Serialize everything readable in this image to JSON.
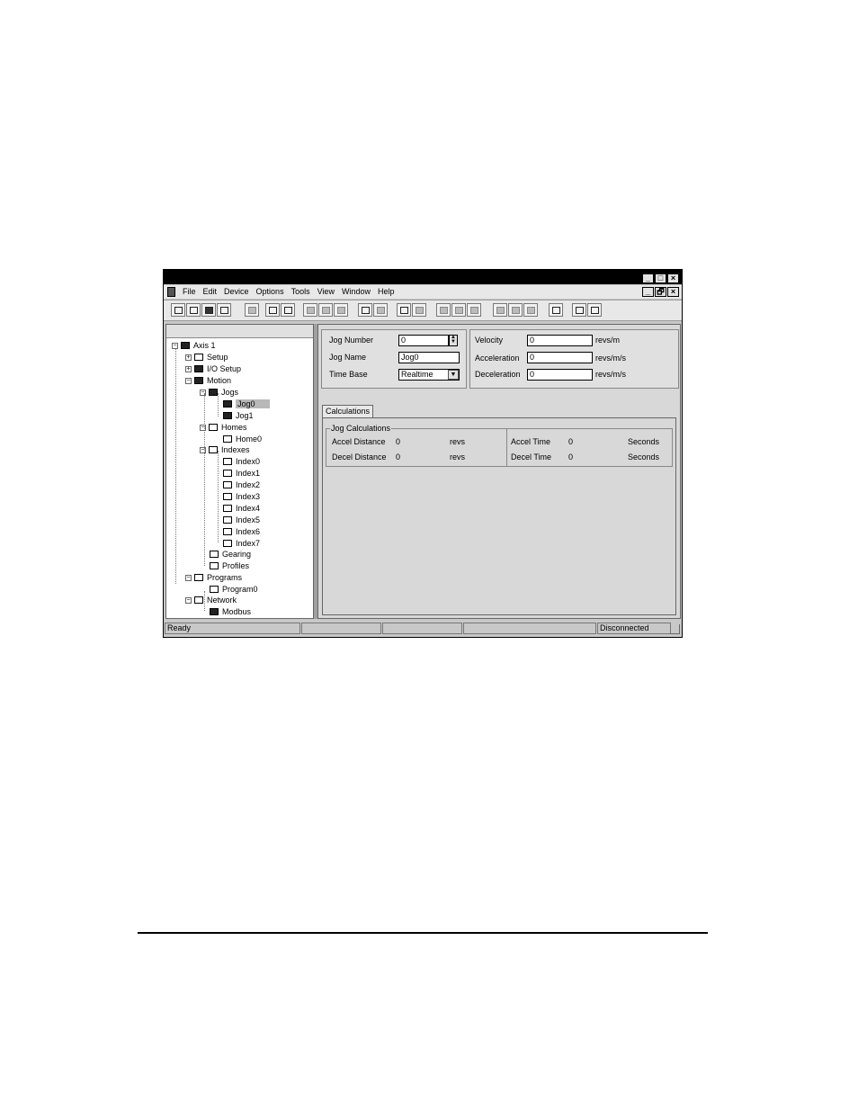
{
  "menubar": {
    "items": [
      "File",
      "Edit",
      "Device",
      "Options",
      "Tools",
      "View",
      "Window",
      "Help"
    ]
  },
  "window_controls": {
    "minimize": "_",
    "maximize": "□",
    "close": "×",
    "restore": "🗗"
  },
  "tree": {
    "root": "Axis 1",
    "setup": "Setup",
    "io_setup": "I/O Setup",
    "motion": "Motion",
    "jogs": "Jogs",
    "jog0": "Jog0",
    "jog1": "Jog1",
    "homes": "Homes",
    "home0": "Home0",
    "indexes": "Indexes",
    "index0": "Index0",
    "index1": "Index1",
    "index2": "Index2",
    "index3": "Index3",
    "index4": "Index4",
    "index5": "Index5",
    "index6": "Index6",
    "index7": "Index7",
    "gearing": "Gearing",
    "profiles": "Profiles",
    "programs": "Programs",
    "program0": "Program0",
    "network": "Network",
    "modbus": "Modbus"
  },
  "jog_form": {
    "jog_number_label": "Jog Number",
    "jog_number_value": "0",
    "jog_name_label": "Jog Name",
    "jog_name_value": "Jog0",
    "time_base_label": "Time Base",
    "time_base_value": "Realtime",
    "velocity_label": "Velocity",
    "velocity_value": "0",
    "velocity_unit": "revs/m",
    "acceleration_label": "Acceleration",
    "acceleration_value": "0",
    "acceleration_unit": "revs/m/s",
    "deceleration_label": "Deceleration",
    "deceleration_value": "0",
    "deceleration_unit": "revs/m/s"
  },
  "calculations": {
    "tab_label": "Calculations",
    "group_label": "Jog Calculations",
    "accel_distance_label": "Accel Distance",
    "accel_distance_value": "0",
    "accel_distance_unit": "revs",
    "decel_distance_label": "Decel Distance",
    "decel_distance_value": "0",
    "decel_distance_unit": "revs",
    "accel_time_label": "Accel Time",
    "accel_time_value": "0",
    "accel_time_unit": "Seconds",
    "decel_time_label": "Decel Time",
    "decel_time_value": "0",
    "decel_time_unit": "Seconds"
  },
  "status": {
    "ready": "Ready",
    "connection": "Disconnected"
  }
}
